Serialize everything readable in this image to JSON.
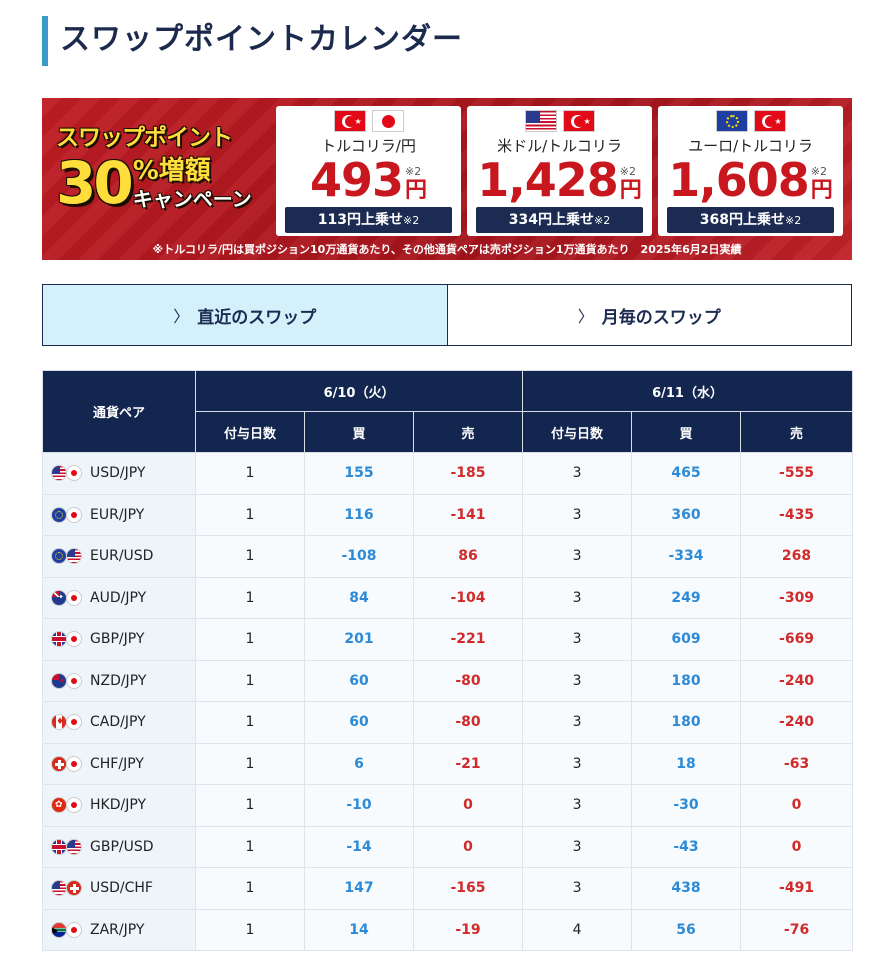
{
  "page": {
    "title": "スワップポイントカレンダー"
  },
  "banner": {
    "promo_line1": "スワップポイント",
    "promo_num": "30",
    "promo_pct": "%増額",
    "promo_camp": "キャンペーン",
    "cards": [
      {
        "flags": [
          "tr",
          "jp"
        ],
        "pair": "トルコリラ/円",
        "value": "493",
        "note": "※2",
        "unit": "円",
        "bonus": "113円上乗せ",
        "bonus_note": "※2"
      },
      {
        "flags": [
          "us",
          "tr"
        ],
        "pair": "米ドル/トルコリラ",
        "value": "1,428",
        "note": "※2",
        "unit": "円",
        "bonus": "334円上乗せ",
        "bonus_note": "※2"
      },
      {
        "flags": [
          "eu",
          "tr"
        ],
        "pair": "ユーロ/トルコリラ",
        "value": "1,608",
        "note": "※2",
        "unit": "円",
        "bonus": "368円上乗せ",
        "bonus_note": "※2"
      }
    ],
    "footnote": "※トルコリラ/円は買ポジション10万通貨あたり、その他通貨ペアは売ポジション1万通貨あたり　2025年6月2日実績"
  },
  "tabs": [
    {
      "label": "直近のスワップ",
      "active": true
    },
    {
      "label": "月毎のスワップ",
      "active": false
    }
  ],
  "table": {
    "pair_header": "通貨ペア",
    "dates": [
      "6/10（火）",
      "6/11（水）"
    ],
    "sub_headers": [
      "付与日数",
      "買",
      "売"
    ],
    "rows": [
      {
        "flags": [
          "us",
          "jp"
        ],
        "pair": "USD/JPY",
        "d1": [
          "1",
          "155",
          "-185"
        ],
        "d2": [
          "3",
          "465",
          "-555"
        ]
      },
      {
        "flags": [
          "eu",
          "jp"
        ],
        "pair": "EUR/JPY",
        "d1": [
          "1",
          "116",
          "-141"
        ],
        "d2": [
          "3",
          "360",
          "-435"
        ]
      },
      {
        "flags": [
          "eu",
          "us"
        ],
        "pair": "EUR/USD",
        "d1": [
          "1",
          "-108",
          "86"
        ],
        "d2": [
          "3",
          "-334",
          "268"
        ]
      },
      {
        "flags": [
          "au",
          "jp"
        ],
        "pair": "AUD/JPY",
        "d1": [
          "1",
          "84",
          "-104"
        ],
        "d2": [
          "3",
          "249",
          "-309"
        ]
      },
      {
        "flags": [
          "gb",
          "jp"
        ],
        "pair": "GBP/JPY",
        "d1": [
          "1",
          "201",
          "-221"
        ],
        "d2": [
          "3",
          "609",
          "-669"
        ]
      },
      {
        "flags": [
          "nz",
          "jp"
        ],
        "pair": "NZD/JPY",
        "d1": [
          "1",
          "60",
          "-80"
        ],
        "d2": [
          "3",
          "180",
          "-240"
        ]
      },
      {
        "flags": [
          "ca",
          "jp"
        ],
        "pair": "CAD/JPY",
        "d1": [
          "1",
          "60",
          "-80"
        ],
        "d2": [
          "3",
          "180",
          "-240"
        ]
      },
      {
        "flags": [
          "ch",
          "jp"
        ],
        "pair": "CHF/JPY",
        "d1": [
          "1",
          "6",
          "-21"
        ],
        "d2": [
          "3",
          "18",
          "-63"
        ]
      },
      {
        "flags": [
          "hk",
          "jp"
        ],
        "pair": "HKD/JPY",
        "d1": [
          "1",
          "-10",
          "0"
        ],
        "d2": [
          "3",
          "-30",
          "0"
        ]
      },
      {
        "flags": [
          "gb",
          "us"
        ],
        "pair": "GBP/USD",
        "d1": [
          "1",
          "-14",
          "0"
        ],
        "d2": [
          "3",
          "-43",
          "0"
        ]
      },
      {
        "flags": [
          "us",
          "ch"
        ],
        "pair": "USD/CHF",
        "d1": [
          "1",
          "147",
          "-165"
        ],
        "d2": [
          "3",
          "438",
          "-491"
        ]
      },
      {
        "flags": [
          "za",
          "jp"
        ],
        "pair": "ZAR/JPY",
        "d1": [
          "1",
          "14",
          "-19"
        ],
        "d2": [
          "4",
          "56",
          "-76"
        ]
      }
    ]
  }
}
